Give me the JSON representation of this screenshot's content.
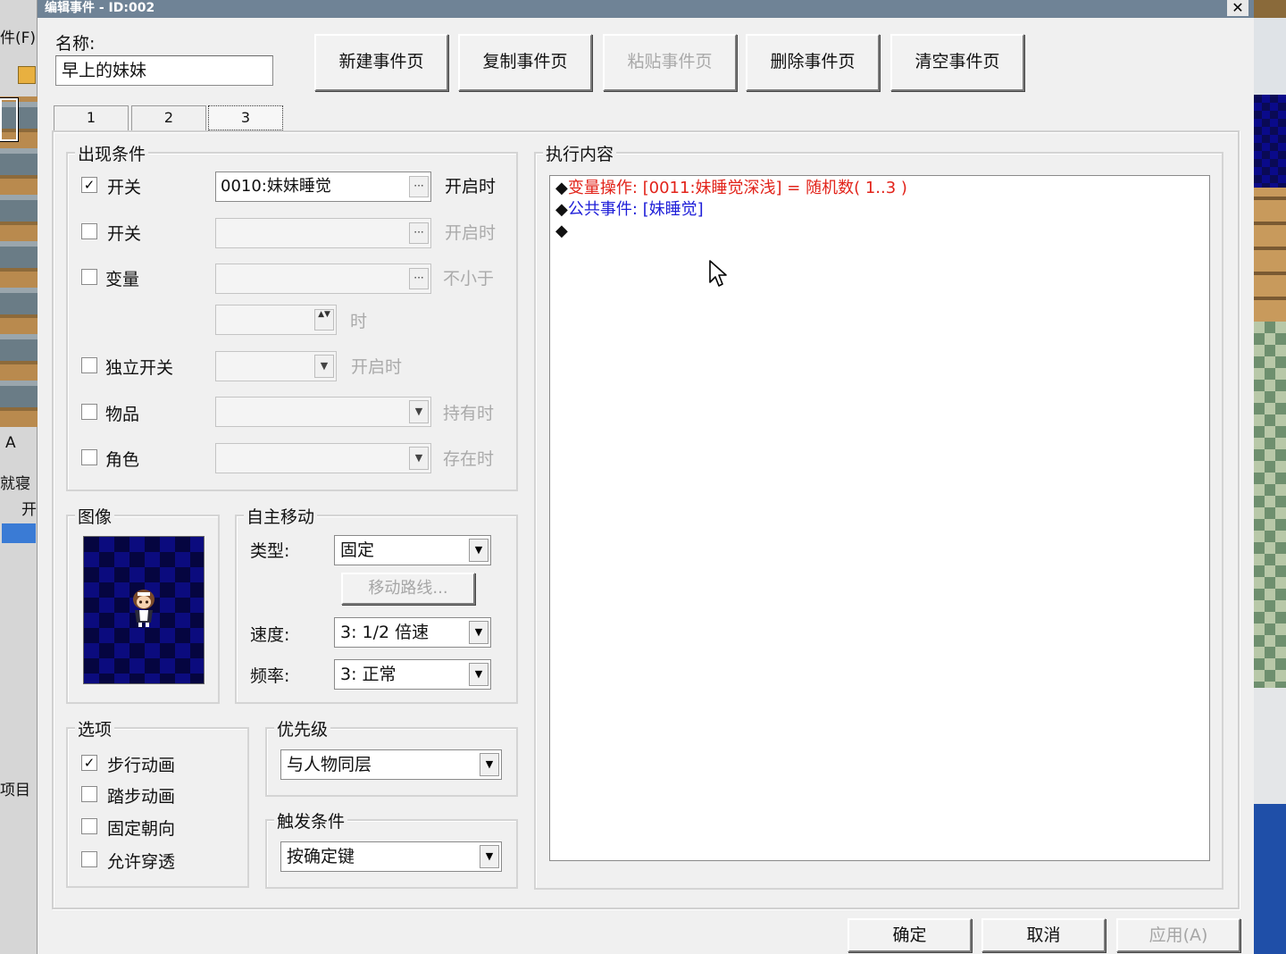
{
  "window": {
    "title": "编辑事件 - ID:002",
    "close": "✕"
  },
  "bg": {
    "left_menu": "件(F)",
    "left_a": "A",
    "left_item1": "就寝",
    "left_item2": "开",
    "left_item3": "项目"
  },
  "name": {
    "label": "名称:",
    "value": "早上的妹妹"
  },
  "toolbar": {
    "new_page": "新建事件页",
    "copy_page": "复制事件页",
    "paste_page": "粘贴事件页",
    "delete_page": "删除事件页",
    "clear_page": "清空事件页"
  },
  "tabs": [
    "1",
    "2",
    "3"
  ],
  "conditions": {
    "title": "出现条件",
    "switch1": {
      "label": "开关",
      "checked": "✓",
      "value": "0010:妹妹睡觉",
      "suffix": "开启时"
    },
    "switch2": {
      "label": "开关",
      "suffix": "开启时"
    },
    "variable": {
      "label": "变量",
      "suffix": "不小于",
      "unit": "时"
    },
    "self_switch": {
      "label": "独立开关",
      "suffix": "开启时"
    },
    "item": {
      "label": "物品",
      "suffix": "持有时"
    },
    "actor": {
      "label": "角色",
      "suffix": "存在时"
    }
  },
  "image": {
    "title": "图像"
  },
  "autonomous": {
    "title": "自主移动",
    "type_label": "类型:",
    "type_value": "固定",
    "route_button": "移动路线...",
    "speed_label": "速度:",
    "speed_value": "3: 1/2 倍速",
    "freq_label": "频率:",
    "freq_value": "3: 正常"
  },
  "options": {
    "title": "选项",
    "walk_anime": {
      "label": "步行动画",
      "checked": "✓"
    },
    "step_anime": {
      "label": "踏步动画"
    },
    "direction_fix": {
      "label": "固定朝向"
    },
    "through": {
      "label": "允许穿透"
    }
  },
  "priority": {
    "title": "优先级",
    "value": "与人物同层"
  },
  "trigger": {
    "title": "触发条件",
    "value": "按确定键"
  },
  "contents": {
    "title": "执行内容",
    "lines": [
      {
        "bullet": "◆",
        "text": "变量操作: [0011:妹睡觉深浅] = 随机数( 1..3 )"
      },
      {
        "bullet": "◆",
        "text": "公共事件: [妹睡觉]"
      },
      {
        "bullet": "◆",
        "text": ""
      }
    ]
  },
  "footer": {
    "ok": "确定",
    "cancel": "取消",
    "apply": "应用(A)"
  },
  "icons": {
    "arrow": "▼",
    "ellipsis": "···",
    "spin": "▲▼"
  },
  "colors": {
    "command_red": "#e2231a",
    "command_blue": "#1e1ed8",
    "titlebar": "#6f8396"
  }
}
